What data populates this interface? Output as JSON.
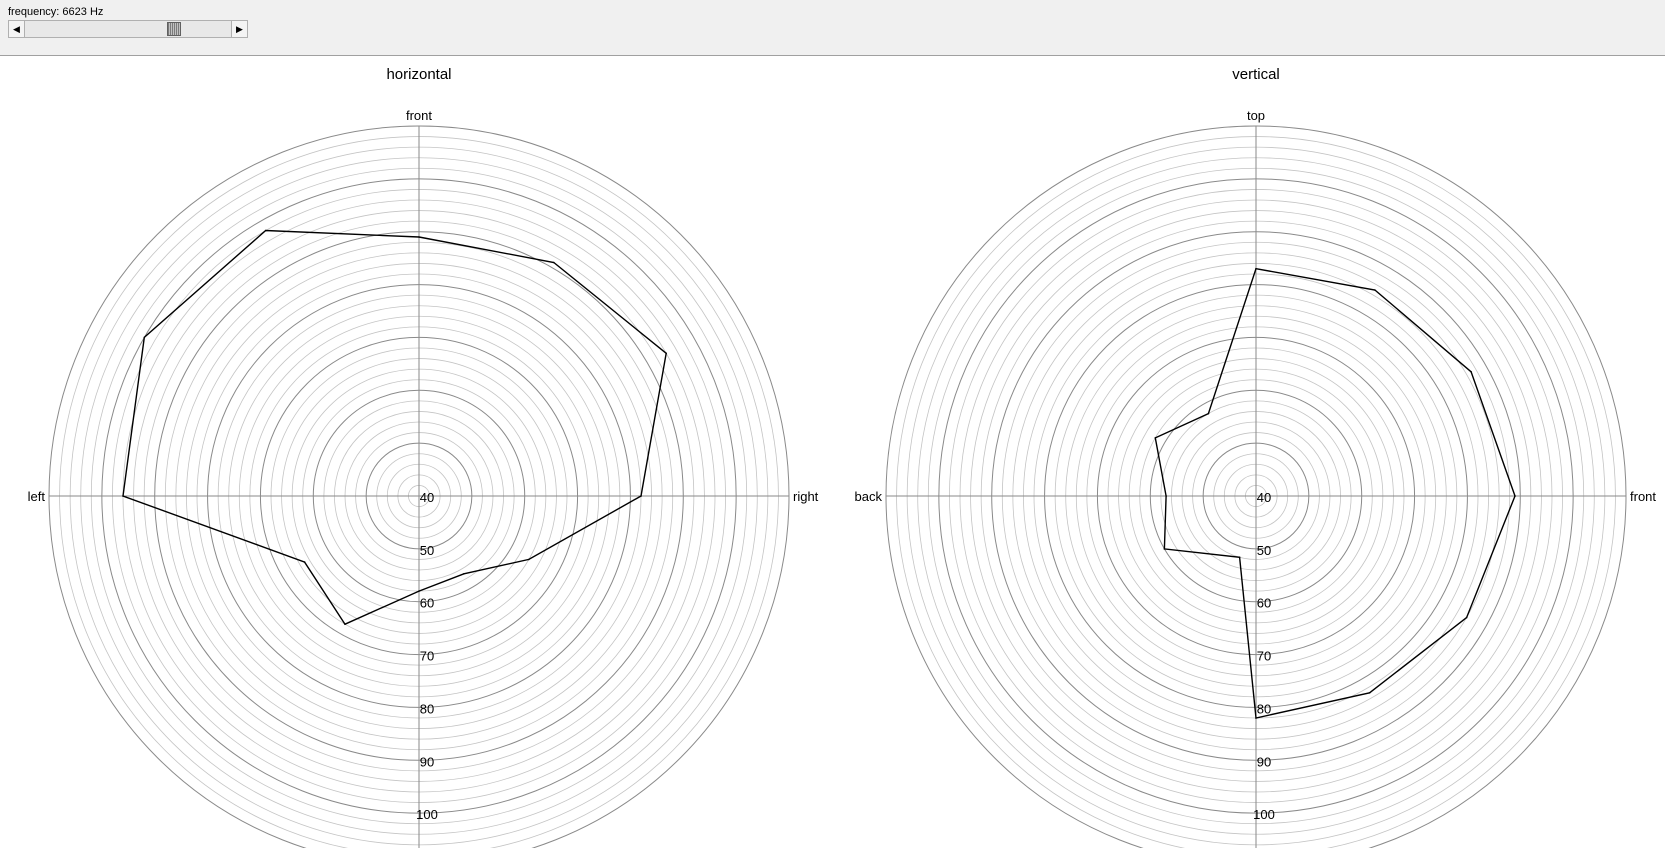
{
  "toolbar": {
    "frequency_label": "frequency: 6623 Hz",
    "slider_position": 0.74,
    "left_arrow_icon": "triangle-left-icon",
    "right_arrow_icon": "triangle-right-icon"
  },
  "chart_data": [
    {
      "type": "polar-line",
      "title": "horizontal",
      "direction_labels": {
        "top": "front",
        "left": "left",
        "right": "right"
      },
      "radial_axis": {
        "inner": 40,
        "outer": 110,
        "tick_labels": [
          "40",
          "50",
          "60",
          "70",
          "80",
          "90",
          "100"
        ],
        "ticks": [
          40,
          50,
          60,
          70,
          80,
          90,
          100
        ],
        "minor_step": 2
      },
      "grid": true,
      "line_color": "#000000",
      "grid_color": "#a0a0a0",
      "series": [
        {
          "points": [
            {
              "angle_deg": 0,
              "value": 89
            },
            {
              "angle_deg": 30,
              "value": 91
            },
            {
              "angle_deg": 60,
              "value": 94
            },
            {
              "angle_deg": 90,
              "value": 82
            },
            {
              "angle_deg": 120,
              "value": 64
            },
            {
              "angle_deg": 150,
              "value": 57
            },
            {
              "angle_deg": 180,
              "value": 58
            },
            {
              "angle_deg": 210,
              "value": 68
            },
            {
              "angle_deg": 240,
              "value": 65
            },
            {
              "angle_deg": 270,
              "value": 96
            },
            {
              "angle_deg": 300,
              "value": 100
            },
            {
              "angle_deg": 330,
              "value": 98
            }
          ]
        }
      ]
    },
    {
      "type": "polar-line",
      "title": "vertical",
      "direction_labels": {
        "top": "top",
        "left": "back",
        "right": "front"
      },
      "radial_axis": {
        "inner": 40,
        "outer": 110,
        "tick_labels": [
          "40",
          "50",
          "60",
          "70",
          "80",
          "90",
          "100"
        ],
        "ticks": [
          40,
          50,
          60,
          70,
          80,
          90,
          100
        ],
        "minor_step": 2
      },
      "grid": true,
      "line_color": "#000000",
      "grid_color": "#a0a0a0",
      "series": [
        {
          "points": [
            {
              "angle_deg": 0,
              "value": 83
            },
            {
              "angle_deg": 30,
              "value": 85
            },
            {
              "angle_deg": 60,
              "value": 87
            },
            {
              "angle_deg": 90,
              "value": 89
            },
            {
              "angle_deg": 120,
              "value": 86
            },
            {
              "angle_deg": 150,
              "value": 83
            },
            {
              "angle_deg": 180,
              "value": 82
            },
            {
              "angle_deg": 195,
              "value": 52
            },
            {
              "angle_deg": 240,
              "value": 60
            },
            {
              "angle_deg": 270,
              "value": 57
            },
            {
              "angle_deg": 300,
              "value": 62
            },
            {
              "angle_deg": 330,
              "value": 58
            }
          ]
        }
      ]
    }
  ]
}
